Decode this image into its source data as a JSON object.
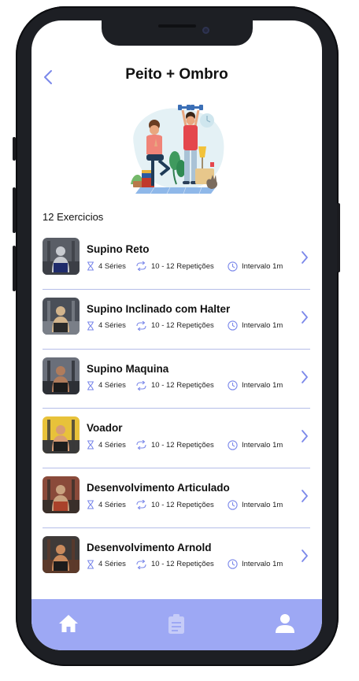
{
  "header": {
    "title": "Peito + Ombro"
  },
  "count_label": "12 Exercicios",
  "colors": {
    "accent": "#7b88ea",
    "tabbar": "#9da8f4",
    "divider": "#b5bde8",
    "text": "#111111"
  },
  "exercises": [
    {
      "name": "Supino Reto",
      "series": "4 Séries",
      "reps": "10 - 12 Repetições",
      "interval": "Intervalo 1m"
    },
    {
      "name": "Supino Inclinado com Halter",
      "series": "4 Séries",
      "reps": "10 - 12 Repetições",
      "interval": "Intervalo 1m"
    },
    {
      "name": "Supino Maquina",
      "series": "4 Séries",
      "reps": "10 - 12 Repetições",
      "interval": "Intervalo 1m"
    },
    {
      "name": "Voador",
      "series": "4 Séries",
      "reps": "10 - 12 Repetições",
      "interval": "Intervalo 1m"
    },
    {
      "name": "Desenvolvimento Articulado",
      "series": "4 Séries",
      "reps": "10 - 12 Repetições",
      "interval": "Intervalo 1m"
    },
    {
      "name": "Desenvolvimento Arnold",
      "series": "4 Séries",
      "reps": "10 - 12 Repetições",
      "interval": "Intervalo 1m"
    }
  ],
  "tabs": [
    {
      "icon": "home-icon"
    },
    {
      "icon": "clipboard-icon"
    },
    {
      "icon": "profile-icon"
    }
  ]
}
